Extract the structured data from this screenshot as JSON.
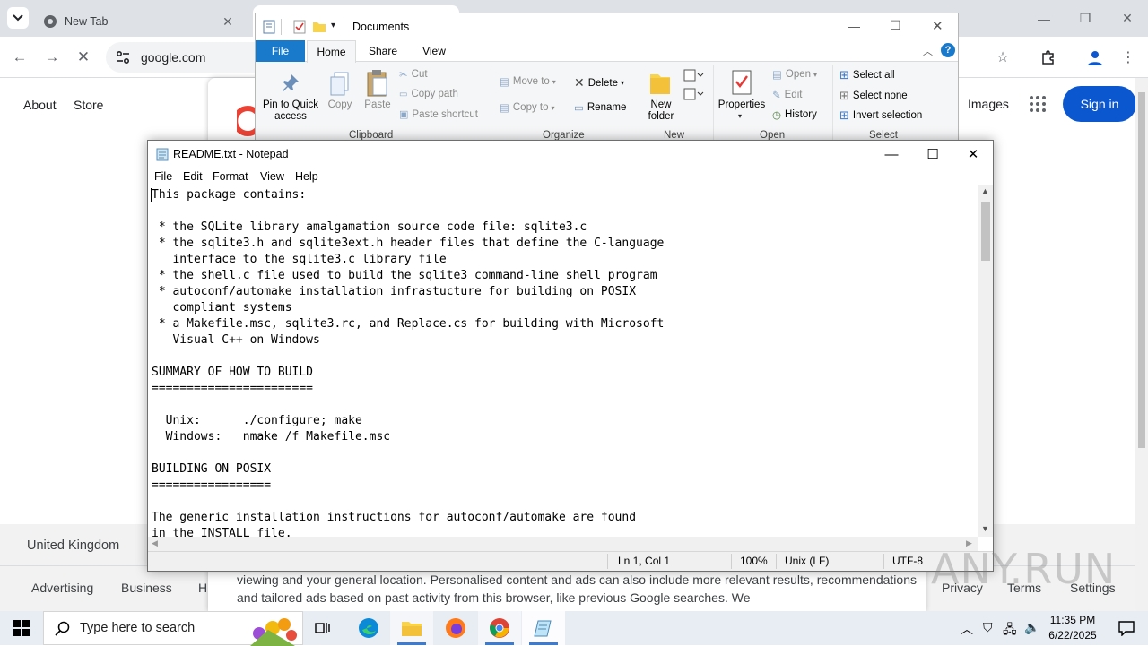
{
  "browser": {
    "tab_title": "New Tab",
    "url": "google.com",
    "google_links": {
      "about": "About",
      "store": "Store",
      "images": "Images",
      "sign_in": "Sign in"
    },
    "footer": {
      "country": "United Kingdom",
      "advertising": "Advertising",
      "business": "Business",
      "how": "H",
      "privacy": "Privacy",
      "terms": "Terms",
      "settings": "Settings"
    },
    "consent_text": "viewing and your general location. Personalised content and ads can also include more relevant results, recommendations and tailored ads based on past activity from this browser, like previous Google searches. We"
  },
  "explorer": {
    "title": "Documents",
    "tabs": [
      "File",
      "Home",
      "Share",
      "View"
    ],
    "clipboard": {
      "pin": "Pin to Quick access",
      "copy": "Copy",
      "paste": "Paste",
      "cut": "Cut",
      "copy_path": "Copy path",
      "paste_shortcut": "Paste shortcut",
      "group": "Clipboard"
    },
    "organize": {
      "move_to": "Move to",
      "copy_to": "Copy to",
      "delete": "Delete",
      "rename": "Rename",
      "group": "Organize"
    },
    "new": {
      "new_folder": "New folder",
      "group": "New"
    },
    "open": {
      "properties": "Properties",
      "open": "Open",
      "edit": "Edit",
      "history": "History",
      "group": "Open"
    },
    "select": {
      "select_all": "Select all",
      "select_none": "Select none",
      "invert": "Invert selection",
      "group": "Select"
    }
  },
  "notepad": {
    "title": "README.txt - Notepad",
    "menu": [
      "File",
      "Edit",
      "Format",
      "View",
      "Help"
    ],
    "content": "This package contains:\n\n * the SQLite library amalgamation source code file: sqlite3.c\n * the sqlite3.h and sqlite3ext.h header files that define the C-language\n   interface to the sqlite3.c library file\n * the shell.c file used to build the sqlite3 command-line shell program\n * autoconf/automake installation infrastucture for building on POSIX\n   compliant systems\n * a Makefile.msc, sqlite3.rc, and Replace.cs for building with Microsoft\n   Visual C++ on Windows\n\nSUMMARY OF HOW TO BUILD\n=======================\n\n  Unix:      ./configure; make\n  Windows:   nmake /f Makefile.msc\n\nBUILDING ON POSIX\n=================\n\nThe generic installation instructions for autoconf/automake are found\nin the INSTALL file.",
    "status": {
      "position": "Ln 1, Col 1",
      "zoom": "100%",
      "line_ending": "Unix (LF)",
      "encoding": "UTF-8"
    }
  },
  "taskbar": {
    "search_placeholder": "Type here to search",
    "time": "11:35 PM",
    "date": "6/22/2025"
  },
  "watermark": "ANY.RUN",
  "colors": {
    "accent_blue": "#0b57d0",
    "file_tab_blue": "#1979ca",
    "taskbar": "#e8ecf3"
  }
}
